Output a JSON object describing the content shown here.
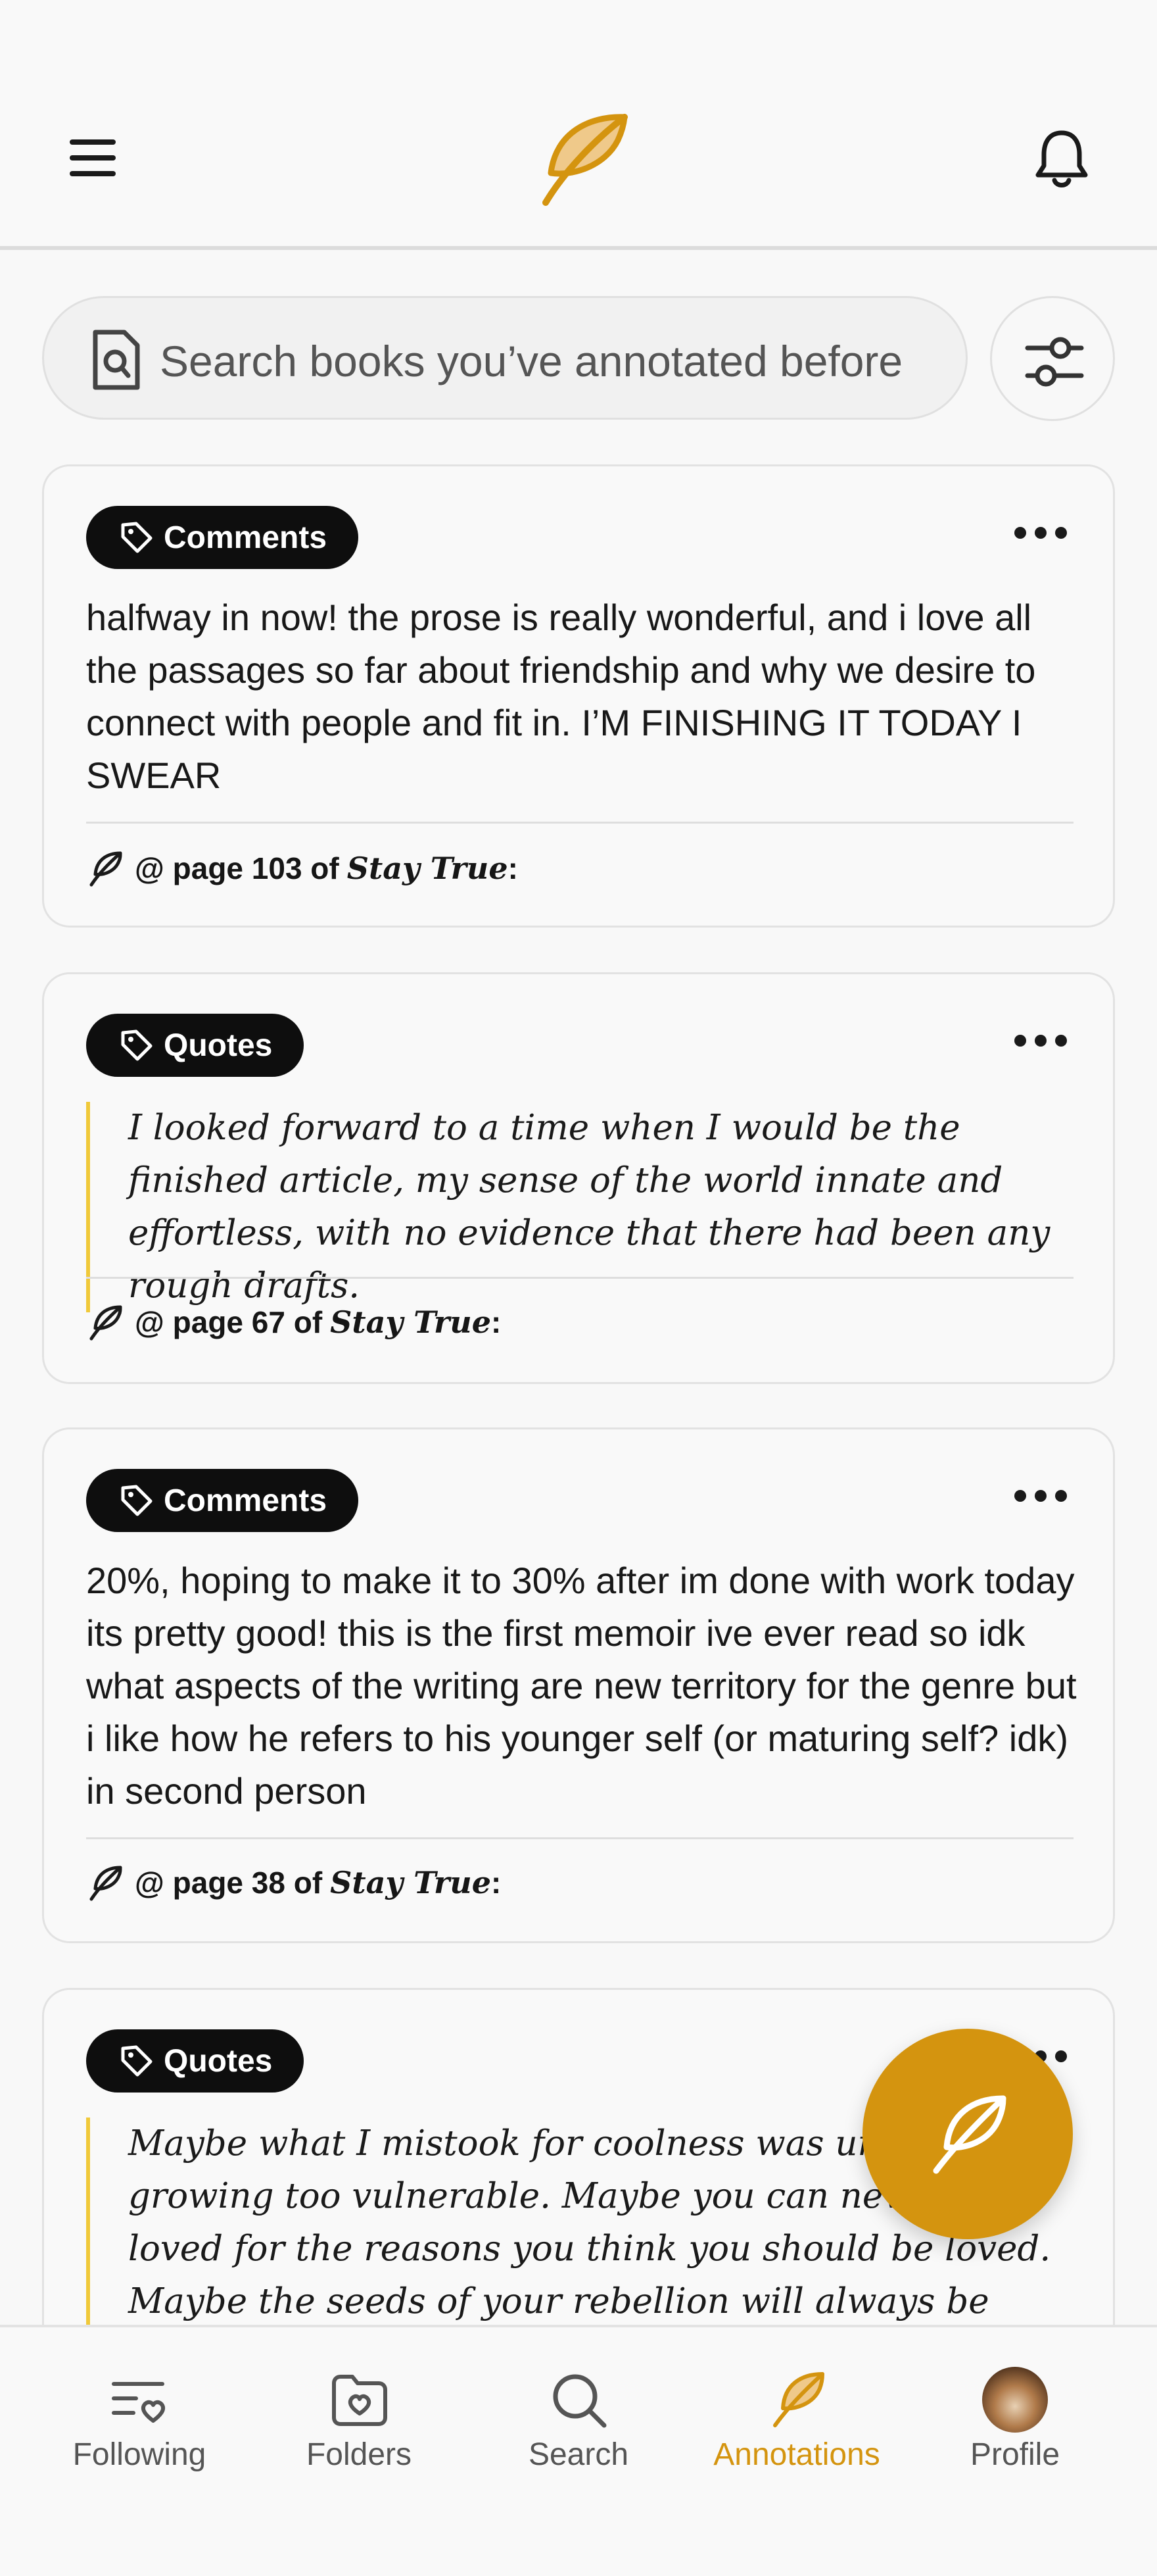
{
  "header": {
    "menu_icon": "hamburger-icon",
    "logo_icon": "feather-logo",
    "notifications_icon": "bell-icon"
  },
  "search": {
    "placeholder": "Search books you’ve annotated before",
    "icon": "document-search-icon",
    "filter_icon": "sliders-icon"
  },
  "cards": [
    {
      "tag": "Comments",
      "kind": "comment",
      "text": "halfway in now! the prose is really wonderful, and i love all the passages so far about friendship and why we desire to connect with people and fit in. I’M FINISHING IT TODAY I SWEAR",
      "source_prefix": "@ page 103 of",
      "book": "Stay True",
      "source_suffix": ":"
    },
    {
      "tag": "Quotes",
      "kind": "quote",
      "text": "I looked forward to a time when I would be the finished article, my sense of the world innate and effortless, with no evidence that there had been any rough drafts.",
      "source_prefix": "@ page 67 of",
      "book": "Stay True",
      "source_suffix": ":"
    },
    {
      "tag": "Comments",
      "kind": "comment",
      "text": "20%, hoping to make it to 30% after im done with work today  its pretty good! this is the first memoir ive ever read so idk what aspects of the writing are new territory for the genre but i like how he refers to his younger self (or maturing self? idk) in second person",
      "source_prefix": "@ page 38 of",
      "book": "Stay True",
      "source_suffix": ":"
    },
    {
      "tag": "Quotes",
      "kind": "quote",
      "text": "Maybe what I mistook for coolness was unease about growing too vulnerable. Maybe you can never be loved for the reasons you think you should be loved. Maybe the seeds of your rebellion will always be forgotten."
    }
  ],
  "fab": {
    "icon": "feather-icon"
  },
  "bottom_nav": {
    "items": [
      {
        "label": "Following",
        "icon": "list-heart-icon"
      },
      {
        "label": "Folders",
        "icon": "folder-heart-icon"
      },
      {
        "label": "Search",
        "icon": "search-icon"
      },
      {
        "label": "Annotations",
        "icon": "feather-icon",
        "active": true
      },
      {
        "label": "Profile",
        "icon": "avatar"
      }
    ]
  },
  "colors": {
    "accent": "#d4940f",
    "quote_bar": "#f0c93a",
    "tag_bg": "#0e0e0e"
  }
}
